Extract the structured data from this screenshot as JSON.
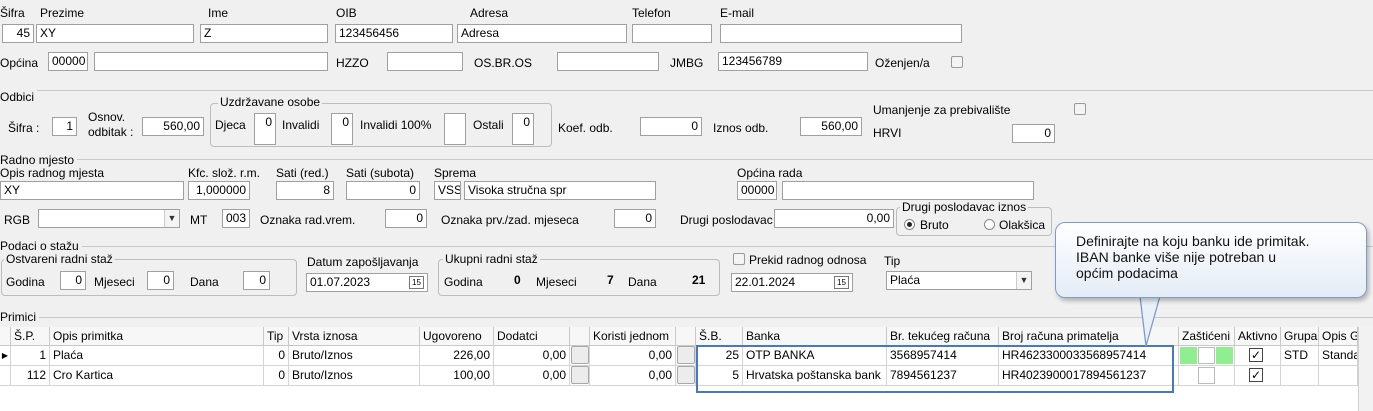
{
  "employee": {
    "labels": {
      "sifra": "Šifra",
      "prezime": "Prezime",
      "ime": "Ime",
      "oib": "OIB",
      "adresa": "Adresa",
      "telefon": "Telefon",
      "email": "E-mail",
      "opcina": "Općina",
      "hzzo": "HZZO",
      "osbros": "OS.BR.OS",
      "jmbg": "JMBG",
      "ozenjen": "Oženjen/a"
    },
    "values": {
      "sifra": "45",
      "prezime": "XY",
      "ime": "Z",
      "oib": "123456456",
      "adresa": "Adresa",
      "telefon": "",
      "email": "",
      "opcina_code": "00000",
      "opcina_name": "",
      "hzzo": "",
      "osbros": "",
      "jmbg": "123456789"
    }
  },
  "odbici": {
    "section": "Odbici",
    "sifra_label": "Šifra :",
    "sifra": "1",
    "osnov_label1": "Osnov.",
    "osnov_label2": "odbitak :",
    "osnov": "560,00",
    "uzdrzavane": "Uzdržavane osobe",
    "djeca_label": "Djeca",
    "djeca": "0",
    "invalidi_label": "Invalidi",
    "invalidi": "0",
    "invalidi100_label": "Invalidi 100%",
    "invalidi100": "",
    "ostali_label": "Ostali",
    "ostali": "0",
    "koef_label": "Koef. odb.",
    "koef": "0",
    "iznos_label": "Iznos odb.",
    "iznos": "560,00",
    "umanjenje_label": "Umanjenje za prebivalište",
    "hrvi_label": "HRVI",
    "hrvi": "0"
  },
  "radno": {
    "section": "Radno mjesto",
    "opis_label": "Opis radnog mjesta",
    "opis": "XY",
    "kfc_label": "Kfc. slož. r.m.",
    "kfc": "1,000000",
    "sati_red_label": "Sati (red.)",
    "sati_red": "8",
    "sati_sub_label": "Sati (subota)",
    "sati_sub": "0",
    "sprema_label": "Sprema",
    "sprema_code": "VSS",
    "sprema": "Visoka stručna spr",
    "opcina_rada_label": "Općina rada",
    "opcina_rada_code": "00000",
    "opcina_rada": "",
    "rgb_label": "RGB",
    "rgb": "",
    "mt_label": "MT",
    "mt": "003",
    "oznaka_rv_label": "Oznaka rad.vrem.",
    "oznaka_rv": "0",
    "oznaka_pz_label": "Oznaka prv./zad. mjeseca",
    "oznaka_pz": "0",
    "drugi_label": "Drugi poslodavac",
    "drugi": "0,00",
    "drugi_iznos_title": "Drugi poslodavac iznos",
    "bruto_label": "Bruto",
    "olaksica_label": "Olakšica"
  },
  "staz": {
    "section": "Podaci o stažu",
    "ostvareni_title": "Ostvareni radni staž",
    "godina_label": "Godina",
    "godina": "0",
    "mjeseci_label": "Mjeseci",
    "mjeseci": "0",
    "dana_label": "Dana",
    "dana": "0",
    "datum_label": "Datum zapošljavanja",
    "datum": "01.07.2023",
    "ukupni_title": "Ukupni radni staž",
    "uk_godina_label": "Godina",
    "uk_godina": "0",
    "uk_mjeseci_label": "Mjeseci",
    "uk_mjeseci": "7",
    "uk_dana_label": "Dana",
    "uk_dana": "21",
    "prekid_label": "Prekid radnog odnosa",
    "prekid_datum": "22.01.2024",
    "tip_label": "Tip",
    "tip": "Plaća"
  },
  "primici": {
    "section": "Primici",
    "headers": [
      "Š.P.",
      "Opis primitka",
      "Tip",
      "Vrsta iznosa",
      "Ugovoreno",
      "Dodatci",
      "Koristi jednom",
      "Š.B.",
      "Banka",
      "Br. tekućeg računa",
      "Broj računa primatelja",
      "Zaštićeni",
      "Aktivno",
      "Grupa",
      "Opis G"
    ],
    "rows": [
      {
        "sp": "1",
        "opis": "Plaća",
        "tip": "0",
        "vrsta": "Bruto/Iznos",
        "ugovoreno": "226,00",
        "dodatci": "0,00",
        "koristi": "0,00",
        "sb": "25",
        "banka": "OTP BANKA",
        "tekuci": "3568957414",
        "primatelj": "HR4623300033568957414",
        "grupa": "STD",
        "opis_g": "Standa"
      },
      {
        "sp": "112",
        "opis": "Cro Kartica",
        "tip": "0",
        "vrsta": "Bruto/Iznos",
        "ugovoreno": "100,00",
        "dodatci": "0,00",
        "koristi": "0,00",
        "sb": "5",
        "banka": "Hrvatska poštanska bank",
        "tekuci": "7894561237",
        "primatelj": "HR4023900017894561237",
        "grupa": "",
        "opis_g": ""
      }
    ]
  },
  "callout": {
    "line1": "Definirajte na koju banku ide primitak.",
    "line2": "IBAN banke više nije potreban u",
    "line3": "općim podacima"
  },
  "colors": {
    "highlight_box": "#4a78c0",
    "callout_border": "#7d9cc8",
    "protected_green": "#90ee90"
  },
  "icons": {
    "calendar": "calendar-icon",
    "dropdown": "chevron-down-icon",
    "row_pointer": "row-pointer-icon",
    "check": "checkmark-icon"
  }
}
